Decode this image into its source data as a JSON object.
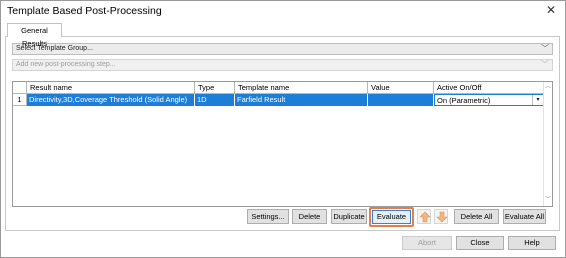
{
  "window": {
    "title": "Template Based Post-Processing",
    "close_glyph": "✕"
  },
  "tabs": [
    {
      "label": "General Results",
      "selected": true
    }
  ],
  "template_group": {
    "value": "Select Template Group..."
  },
  "add_step": {
    "value": "Add new post-processing step..."
  },
  "table": {
    "columns": [
      "Result name",
      "Type",
      "Template name",
      "Value",
      "Active On/Off"
    ],
    "rows": [
      {
        "index": "1",
        "result_name": "Directivity,3D,Coverage Threshold (Solid Angle)",
        "type": "1D",
        "template_name": "Farfield Result",
        "value": "",
        "active": "On (Parametric)"
      }
    ]
  },
  "actions": {
    "settings": "Settings...",
    "delete": "Delete",
    "duplicate": "Duplicate",
    "evaluate": "Evaluate",
    "delete_all": "Delete All",
    "evaluate_all": "Evaluate All"
  },
  "footer": {
    "abort": "Abort",
    "close": "Close",
    "help": "Help"
  },
  "colors": {
    "selection": "#1e7ed7",
    "highlight_ring": "#e37d49",
    "arrow_icon": "#f2b67a"
  },
  "icons": {
    "move_up": "arrow-up-icon",
    "move_down": "arrow-down-icon"
  }
}
